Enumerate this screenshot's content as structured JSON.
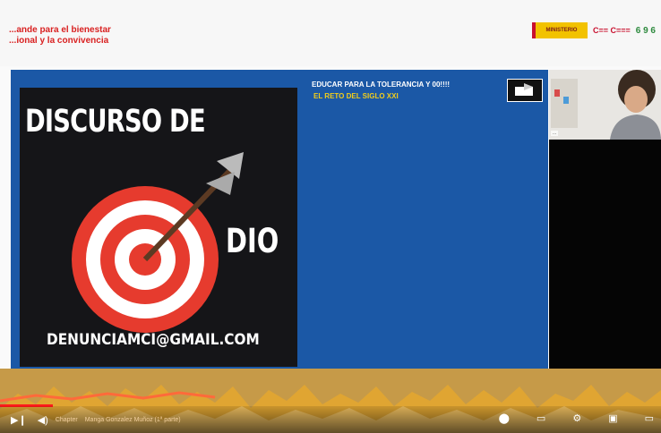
{
  "banner": {
    "title_line1": "...ande para el bienestar",
    "title_line2": "...ional y la convivencia"
  },
  "logos": {
    "gov_label": "MINISTERIO",
    "small_label": "C== C===",
    "green_label": "6 9 6"
  },
  "slide": {
    "title": "EDUCAR PARA LA TOLERANCIA Y 00!!!!",
    "subtitle": "EL RETO DEL SIGLO XXI"
  },
  "poster": {
    "title": "DISCURSO DE",
    "word_end": "DIO",
    "email": "DENUNCIAMCI@GMAIL.COM"
  },
  "webcam": {
    "label": "..."
  },
  "player": {
    "chapter_text": "Chapter",
    "video_title": "Manga Gonzalez Muñoz (1ª parte)",
    "progress": 0.08
  }
}
